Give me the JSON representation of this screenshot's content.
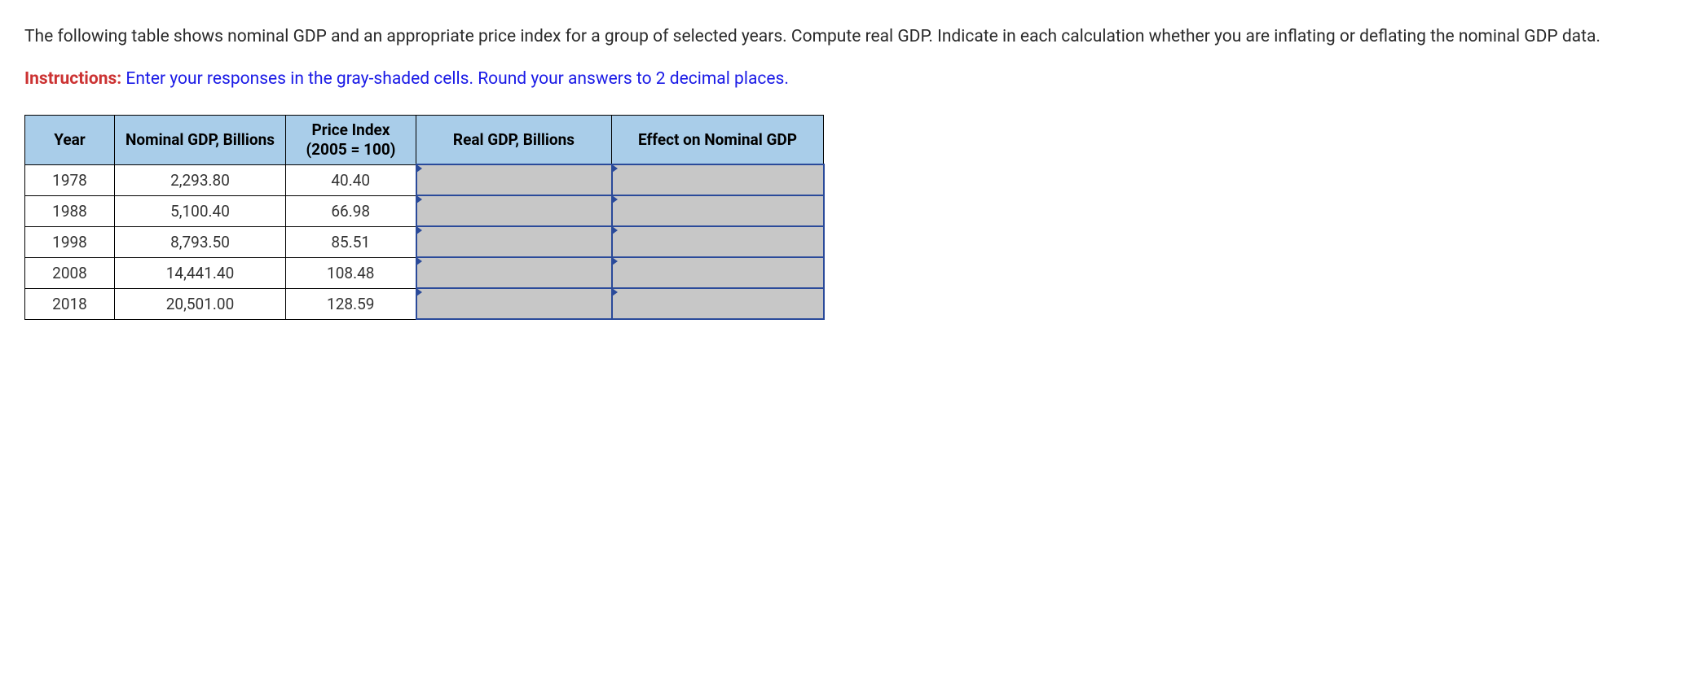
{
  "intro": "The following table shows nominal GDP and an appropriate price index for a group of selected years. Compute real GDP. Indicate in each calculation whether you are inflating or deflating the nominal GDP data.",
  "instructions": {
    "label": "Instructions:",
    "text": " Enter your responses in the gray-shaded cells. Round your answers to 2 decimal places."
  },
  "table": {
    "headers": {
      "year": "Year",
      "nominal": "Nominal GDP, Billions",
      "priceIndex": "Price Index (2005 = 100)",
      "realGdp": "Real GDP, Billions",
      "effect": "Effect on Nominal GDP"
    },
    "rows": [
      {
        "year": "1978",
        "nominal": "2,293.80",
        "priceIndex": "40.40"
      },
      {
        "year": "1988",
        "nominal": "5,100.40",
        "priceIndex": "66.98"
      },
      {
        "year": "1998",
        "nominal": "8,793.50",
        "priceIndex": "85.51"
      },
      {
        "year": "2008",
        "nominal": "14,441.40",
        "priceIndex": "108.48"
      },
      {
        "year": "2018",
        "nominal": "20,501.00",
        "priceIndex": "128.59"
      }
    ]
  }
}
